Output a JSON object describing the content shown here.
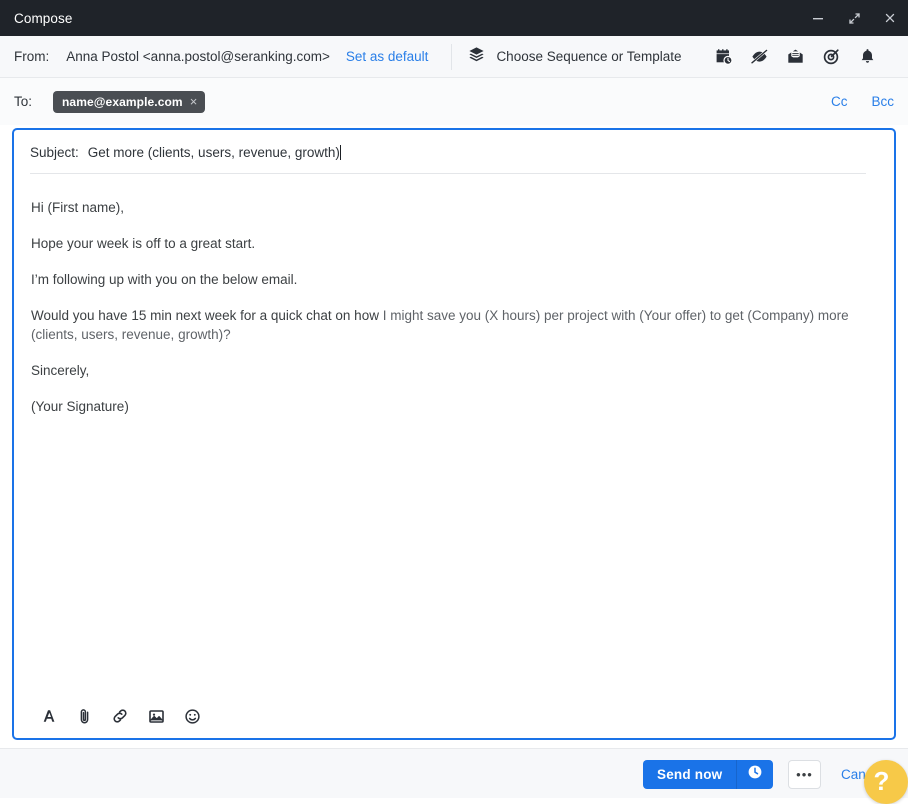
{
  "window": {
    "title": "Compose",
    "controls": {
      "minimize": "minimize-icon",
      "expand": "expand-icon",
      "close": "close-icon"
    }
  },
  "from": {
    "label": "From:",
    "value": "Anna Postol <anna.postol@seranking.com>",
    "set_as_default": "Set as default"
  },
  "toolbar": {
    "sequence_label": "Choose Sequence or Template",
    "sequence_icon": "layers-icon",
    "icons": [
      "calendar-clock-icon",
      "tracking-off-icon",
      "open-mail-icon",
      "target-icon",
      "bell-icon"
    ]
  },
  "to": {
    "label": "To:",
    "recipients": [
      {
        "email": "name@example.com",
        "remove": "×"
      }
    ],
    "cc": "Cc",
    "bcc": "Bcc"
  },
  "subject": {
    "label": "Subject:",
    "value": "Get more (clients, users, revenue, growth)"
  },
  "body": {
    "greeting": "Hi (First name),",
    "line2": "Hope your week is off to a great start.",
    "line3": "I’m following up with you on the below email.",
    "line4_part1": "Would you have 15 min next week for a quick chat on how ",
    "line4_part2": "I might save you (X hours) per project with  (Your offer) to get (Company) more (clients, users, revenue, growth)?",
    "closing": "Sincerely,",
    "signature": "(Your Signature)"
  },
  "format_bar": {
    "icons": [
      "font-icon",
      "attachment-icon",
      "link-icon",
      "image-icon",
      "emoji-icon"
    ]
  },
  "footer": {
    "send_now": "Send now",
    "schedule_icon": "clock-icon",
    "more": "•••",
    "cancel": "Cancel",
    "help": "?"
  },
  "colors": {
    "titlebar_bg": "#1f2329",
    "accent_blue": "#1a73e8",
    "link_blue": "#2a7fe8",
    "chip_bg": "#4a4e53",
    "help_yellow": "#f7c948",
    "body_text": "#3c4043"
  }
}
